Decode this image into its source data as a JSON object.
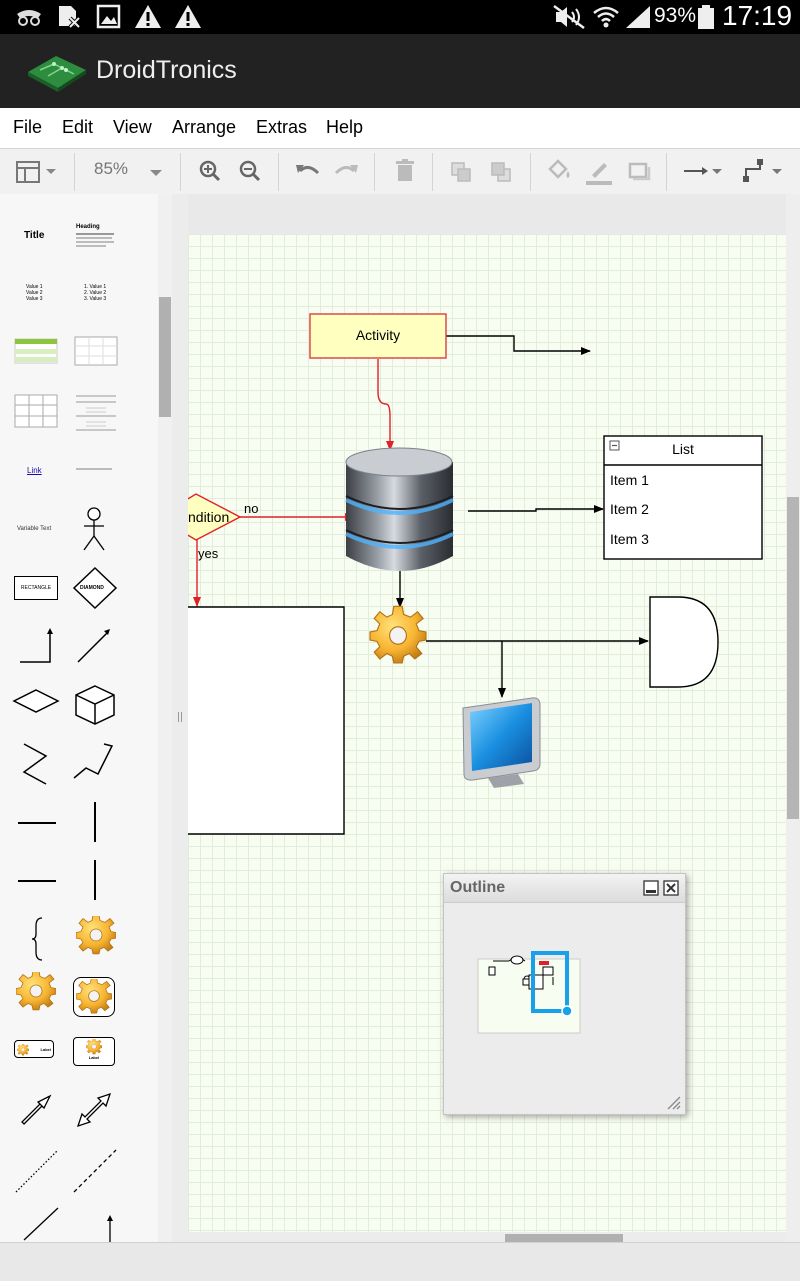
{
  "status_bar": {
    "battery": "93%",
    "time": "17:19",
    "icons": [
      "incognito-icon",
      "sim-card-x-icon",
      "image-icon",
      "warning-icon",
      "warning-icon",
      "mute-icon",
      "wifi-icon",
      "signal-icon",
      "battery-icon"
    ]
  },
  "app": {
    "title": "DroidTronics"
  },
  "menu": [
    "File",
    "Edit",
    "View",
    "Arrange",
    "Extras",
    "Help"
  ],
  "toolbar": {
    "zoom": "85%",
    "tools": [
      "format-panel",
      "zoom-in",
      "zoom-out",
      "undo",
      "redo",
      "delete",
      "to-front",
      "to-back",
      "fill-color",
      "line-color",
      "shadow",
      "connection-style",
      "waypoints"
    ]
  },
  "sidebar": {
    "title_label": "Title",
    "heading_label": "Heading",
    "bullets": [
      "Value 1",
      "Value 2",
      "Value 3"
    ],
    "numbered": [
      "1.  Value 1",
      "2.  Value 2",
      "3.  Value 3"
    ],
    "link_label": "Link",
    "variable_text": "Variable Text",
    "rectangle_label": "RECTANGLE",
    "diamond_label": "DIAMOND",
    "label_label": "Label"
  },
  "diagram": {
    "activity": "Activity",
    "condition": "ndition",
    "no": "no",
    "yes": "yes",
    "list_title": "List",
    "list_items": [
      "Item 1",
      "Item 2",
      "Item 3"
    ]
  },
  "outline": {
    "title": "Outline"
  },
  "colors": {
    "activity_fill": "#ffffc0",
    "activity_stroke": "#d94040",
    "connector_red": "#e0202a",
    "page_bg": "#f8fdf1",
    "grid": "#e3ecdb",
    "outline_accent": "#18a0e8"
  }
}
